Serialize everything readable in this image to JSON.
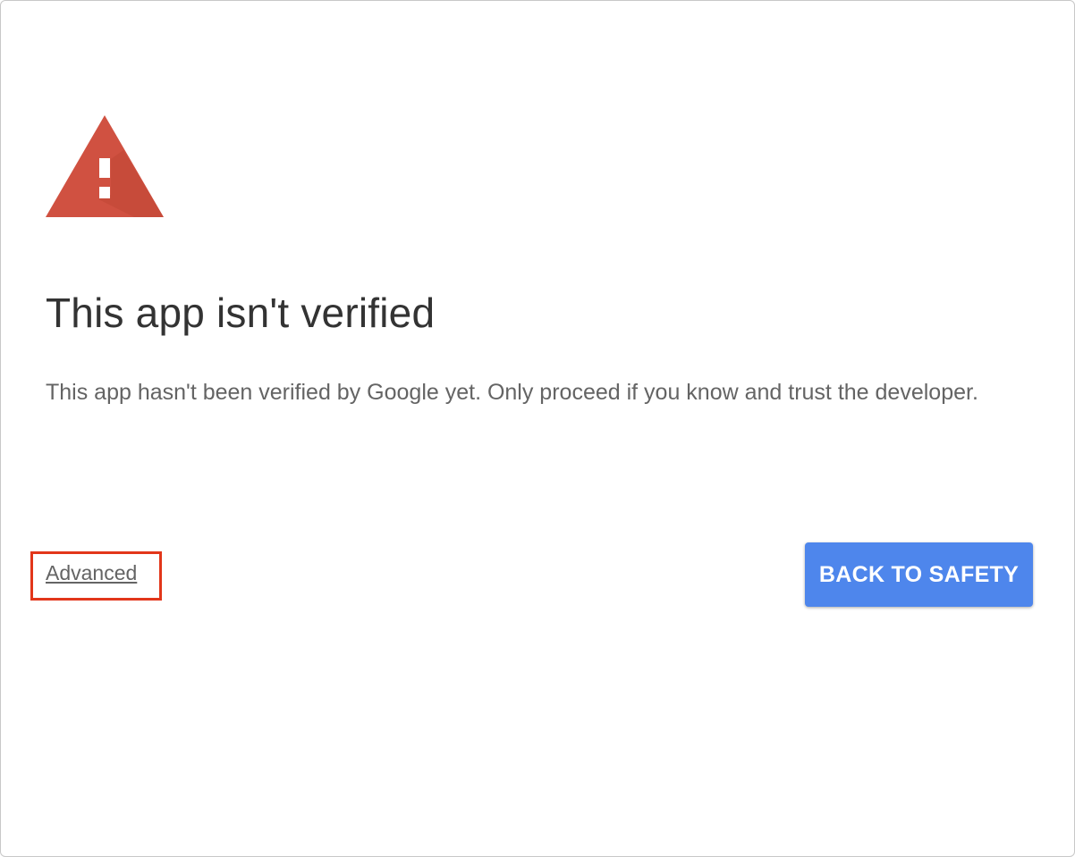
{
  "icon": {
    "name": "warning-triangle-icon",
    "color": "#d05141"
  },
  "title": "This app isn't verified",
  "description": "This app hasn't been verified by Google yet. Only proceed if you know and trust the developer.",
  "actions": {
    "advanced_label": "Advanced",
    "back_label": "BACK TO SAFETY"
  },
  "colors": {
    "primary_button": "#4e86ec",
    "highlight_box": "#e2361a",
    "warning": "#d05141"
  }
}
